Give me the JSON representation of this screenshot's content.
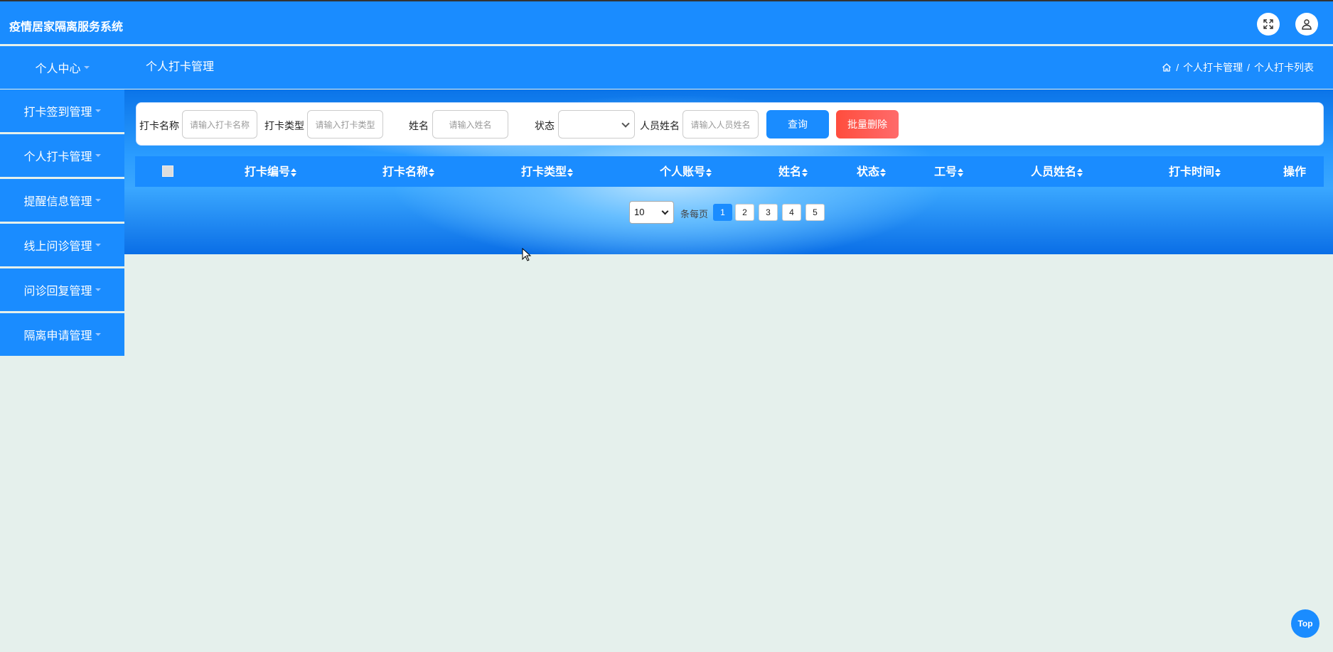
{
  "app": {
    "title": "疫情居家隔离服务系统"
  },
  "header_icons": {
    "fullscreen": "fullscreen-icon",
    "user": "user-icon"
  },
  "nav": {
    "personal_center": "个人中心",
    "page_title": "个人打卡管理",
    "breadcrumb": [
      "个人打卡管理",
      "个人打卡列表"
    ],
    "separator": "/"
  },
  "sidebar": {
    "items": [
      {
        "label": "打卡签到管理"
      },
      {
        "label": "个人打卡管理"
      },
      {
        "label": "提醒信息管理"
      },
      {
        "label": "线上问诊管理"
      },
      {
        "label": "问诊回复管理"
      },
      {
        "label": "隔离申请管理"
      }
    ]
  },
  "search": {
    "fields": [
      {
        "label": "打卡名称",
        "placeholder": "请输入打卡名称"
      },
      {
        "label": "打卡类型",
        "placeholder": "请输入打卡类型"
      },
      {
        "label": "姓名",
        "placeholder": "请输入姓名"
      },
      {
        "label": "状态",
        "value": ""
      },
      {
        "label": "人员姓名",
        "placeholder": "请输入人员姓名"
      }
    ],
    "query_button": "查询",
    "batch_delete_button": "批量删除"
  },
  "table": {
    "columns": [
      "打卡编号",
      "打卡名称",
      "打卡类型",
      "个人账号",
      "姓名",
      "状态",
      "工号",
      "人员姓名",
      "打卡时间",
      "操作"
    ],
    "rows": []
  },
  "pagination": {
    "page_size": "10",
    "per_page_label": "条每页",
    "pages": [
      "1",
      "2",
      "3",
      "4",
      "5"
    ],
    "current_page": 1
  },
  "back_to_top": "Top",
  "colors": {
    "primary": "#1a8cff",
    "danger": "#ff5a4a",
    "background": "#e5f0ec"
  }
}
